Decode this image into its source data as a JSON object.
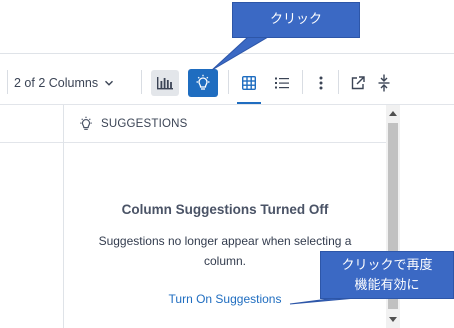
{
  "toolbar": {
    "columns_label": "2 of 2 Columns",
    "icons": {
      "dropdown": "chevron-down-icon",
      "chart": "bar-chart-icon",
      "suggestions": "lightbulb-icon",
      "grid": "table-grid-icon",
      "list": "list-icon",
      "more": "more-vertical-icon",
      "popout": "external-link-icon",
      "collapse": "collapse-icon"
    }
  },
  "suggestions_panel": {
    "title": "SUGGESTIONS",
    "empty_title": "Column Suggestions Turned Off",
    "empty_description": "Suggestions no longer appear when selecting a column.",
    "turn_on_link": "Turn On Suggestions"
  },
  "annotations": {
    "click": "クリック",
    "reenable_line1": "クリックで再度",
    "reenable_line2": "機能有効に"
  },
  "colors": {
    "accent": "#1f6dc0",
    "callout": "#3b69c4",
    "chart_button_bg": "#e3e6ea"
  }
}
